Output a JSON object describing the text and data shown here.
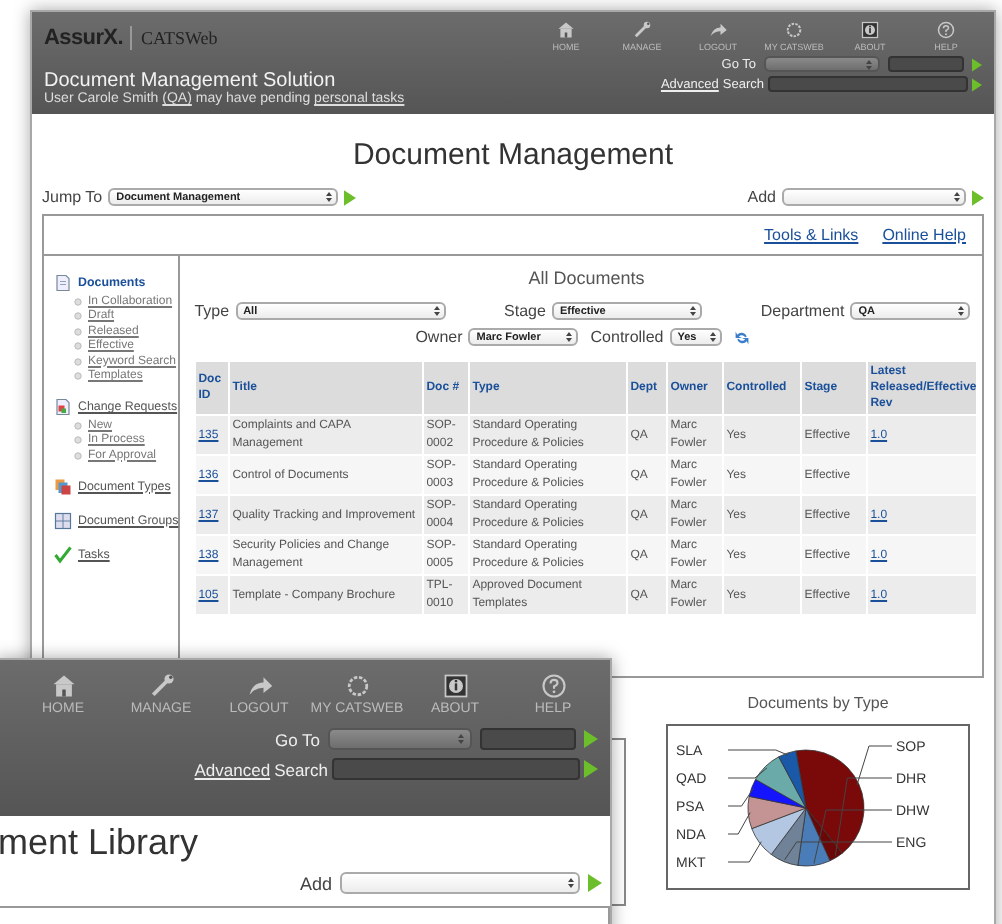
{
  "back_window": {
    "header": {
      "brand": "AssurX.",
      "product": "CATSWeb",
      "title": "Document Management Solution",
      "user_line": {
        "prefix": "User Carole Smith",
        "dept_link": "(QA)",
        "middle": "may have pending",
        "tasks_link": "personal tasks"
      },
      "nav": [
        {
          "kind": "home",
          "label": "HOME"
        },
        {
          "kind": "wrench",
          "label": "MANAGE"
        },
        {
          "kind": "arrow",
          "label": "LOGOUT"
        },
        {
          "kind": "ring",
          "label": "MY CATSWEB"
        },
        {
          "kind": "info",
          "label": "ABOUT"
        },
        {
          "kind": "help",
          "label": "HELP"
        }
      ],
      "go_to_label": "Go To",
      "advanced_link": "Advanced",
      "search_label": "Search"
    },
    "page_title": "Document Management",
    "jump_to": {
      "label": "Jump To",
      "value": "Document Management"
    },
    "add_label": "Add",
    "top_links": [
      "Tools & Links",
      "Online Help"
    ],
    "sidebar": [
      {
        "kind": "document",
        "label": "Documents",
        "selected": true,
        "children": [
          "In Collaboration",
          "Draft",
          "Released",
          "Effective",
          "Keyword Search",
          "Templates"
        ]
      },
      {
        "kind": "change",
        "label": "Change Requests",
        "selected": false,
        "children": [
          "New",
          "In Process",
          "For Approval"
        ]
      },
      {
        "kind": "types",
        "label": "Document Types",
        "selected": false
      },
      {
        "kind": "groups",
        "label": "Document Groups",
        "selected": false
      },
      {
        "kind": "check",
        "label": "Tasks",
        "selected": false
      }
    ],
    "list_title": "All Documents",
    "filters_row_1": [
      {
        "label": "Type",
        "value": "All"
      },
      {
        "label": "Stage",
        "value": "Effective"
      },
      {
        "label": "Department",
        "value": "QA"
      }
    ],
    "filters_row_2": [
      {
        "label": "Owner",
        "value": "Marc Fowler"
      },
      {
        "label": "Controlled",
        "value": "Yes"
      }
    ],
    "table": {
      "columns": [
        "Doc ID",
        "Title",
        "Doc #",
        "Type",
        "Dept",
        "Owner",
        "Controlled",
        "Stage",
        "Latest Released/Effective Rev"
      ],
      "rows": [
        {
          "id": "135",
          "title": "Complaints and CAPA Management",
          "doc_no": "SOP-0002",
          "type": "Standard Operating Procedure & Policies",
          "dept": "QA",
          "owner": "Marc Fowler",
          "controlled": "Yes",
          "stage": "Effective",
          "rev": "1.0"
        },
        {
          "id": "136",
          "title": "Control of Documents",
          "doc_no": "SOP-0003",
          "type": "Standard Operating Procedure & Policies",
          "dept": "QA",
          "owner": "Marc Fowler",
          "controlled": "Yes",
          "stage": "Effective"
        },
        {
          "id": "137",
          "title": "Quality Tracking and Improvement",
          "doc_no": "SOP-0004",
          "type": "Standard Operating Procedure & Policies",
          "dept": "QA",
          "owner": "Marc Fowler",
          "controlled": "Yes",
          "stage": "Effective",
          "rev": "1.0"
        },
        {
          "id": "138",
          "title": "Security Policies and Change Management",
          "doc_no": "SOP-0005",
          "type": "Standard Operating Procedure & Policies",
          "dept": "QA",
          "owner": "Marc Fowler",
          "controlled": "Yes",
          "stage": "Effective",
          "rev": "1.0"
        },
        {
          "id": "105",
          "title": "Template - Company Brochure",
          "doc_no": "TPL-0010",
          "type": "Approved Document Templates",
          "dept": "QA",
          "owner": "Marc Fowler",
          "controlled": "Yes",
          "stage": "Effective",
          "rev": "1.0"
        }
      ]
    },
    "chart": {
      "title": "Documents by Type",
      "slices": [
        {
          "label": "SLA",
          "color": "#1a58a8"
        },
        {
          "label": "QAD",
          "color": "#6aaaa8"
        },
        {
          "label": "PSA",
          "color": "#1414ff"
        },
        {
          "label": "NDA",
          "color": "#c49494"
        },
        {
          "label": "MKT",
          "color": "#b4c7e2"
        },
        {
          "label": "SOP",
          "color": "#7a0a0a"
        },
        {
          "label": "DHR",
          "color": "#6a0808"
        },
        {
          "label": "DHW",
          "color": "#4a7db8"
        },
        {
          "label": "ENG",
          "color": "#6f8298"
        }
      ]
    }
  },
  "front_window": {
    "nav": [
      {
        "kind": "home",
        "label": "HOME"
      },
      {
        "kind": "wrench",
        "label": "MANAGE"
      },
      {
        "kind": "arrow",
        "label": "LOGOUT"
      },
      {
        "kind": "ring",
        "label": "MY CATSWEB"
      },
      {
        "kind": "info",
        "label": "ABOUT"
      },
      {
        "kind": "help",
        "label": "HELP"
      }
    ],
    "go_to_label": "Go To",
    "advanced_link": "Advanced",
    "search_label": "Search",
    "page_title": "ment Library",
    "add_label": "Add"
  }
}
